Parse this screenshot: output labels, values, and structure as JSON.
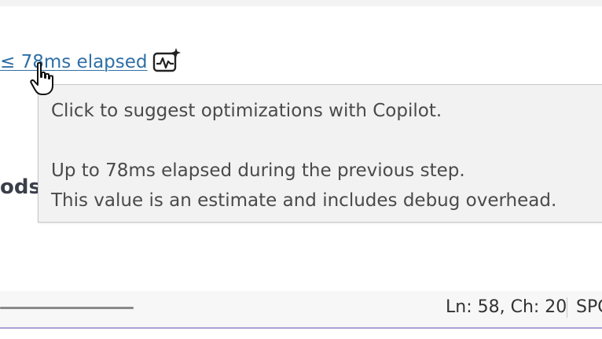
{
  "editor": {
    "perf_tip_text": "≤ 78ms elapsed",
    "code_fragment": "ods",
    "copilot_icon": "copilot-sparkle-icon"
  },
  "tooltip": {
    "line1": "Click to suggest optimizations with Copilot.",
    "line2": "Up to 78ms elapsed during the previous step.",
    "line3": "This value is an estimate and includes debug overhead."
  },
  "status_bar": {
    "position": "Ln: 58, Ch: 20",
    "whitespace": "SPC"
  },
  "colors": {
    "link": "#2f6fa6",
    "tooltip_bg": "#f2f2f2",
    "status_accent": "#a9a2d6"
  }
}
